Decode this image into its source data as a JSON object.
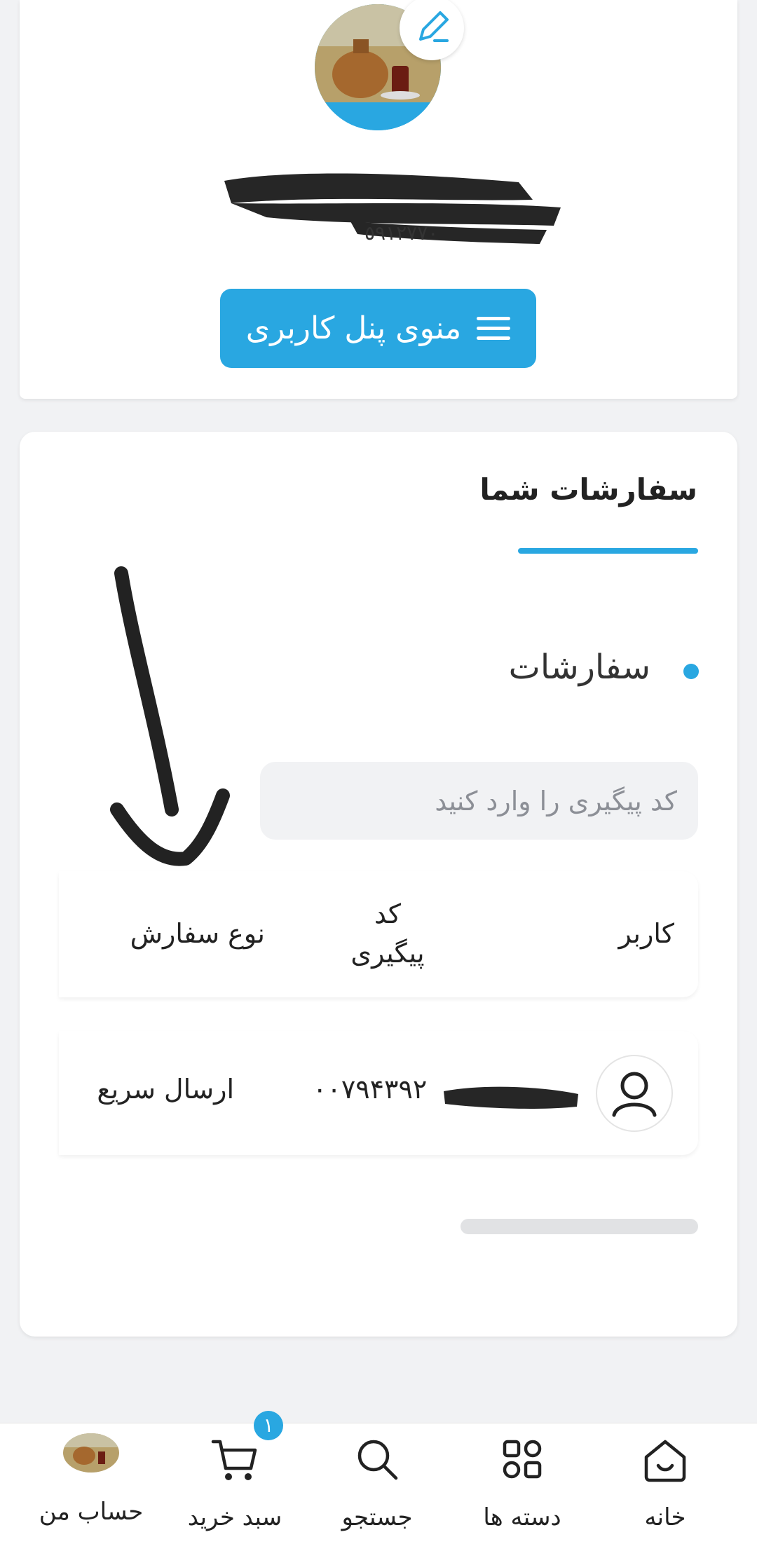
{
  "profile": {
    "menu_button_label": "منوی پنل کاربری",
    "edit_icon": "pencil-icon",
    "menu_icon": "hamburger-icon"
  },
  "orders": {
    "title": "سفارشات شما",
    "section_label": "سفارشات",
    "search_placeholder": "کد پیگیری را وارد کنید",
    "columns": {
      "user": "کاربر",
      "tracking_code": "کد پیگیری",
      "order_type": "نوع سفارش"
    },
    "rows": [
      {
        "tracking_code": "۰۰۷۹۴۳۹۲",
        "order_type": "ارسال سریع"
      }
    ]
  },
  "nav": {
    "items": [
      {
        "label": "خانه",
        "icon": "home-icon"
      },
      {
        "label": "دسته ها",
        "icon": "categories-icon"
      },
      {
        "label": "جستجو",
        "icon": "search-icon"
      },
      {
        "label": "سبد خرید",
        "icon": "cart-icon"
      },
      {
        "label": "حساب من",
        "icon": "account-avatar"
      }
    ],
    "cart_count": "۱"
  },
  "colors": {
    "accent": "#29a7e1",
    "background": "#f1f2f4"
  }
}
